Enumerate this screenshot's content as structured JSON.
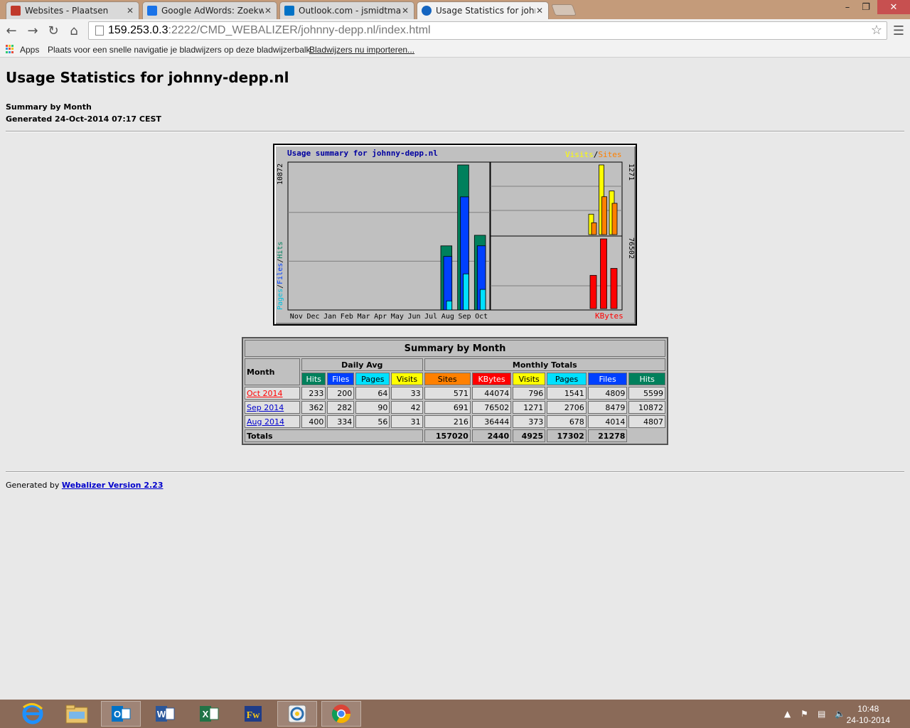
{
  "browser": {
    "tabs": [
      {
        "label": "Websites - Plaatsen",
        "favicon_color": "#c0392b",
        "active": false
      },
      {
        "label": "Google AdWords: Zoekwo",
        "favicon_color": "#1a73e8",
        "active": false
      },
      {
        "label": "Outlook.com - jsmidtman",
        "favicon_color": "#0072c6",
        "active": false
      },
      {
        "label": "Usage Statistics for johnny",
        "favicon_color": "#1565c0",
        "active": true
      }
    ],
    "url_host": "159.253.0.3",
    "url_path": ":2222/CMD_WEBALIZER/johnny-depp.nl/index.html",
    "bookmarks_apps": "Apps",
    "bookmarks_hint": "Plaats voor een snelle navigatie je bladwijzers op deze bladwijzerbalk.",
    "bookmarks_import": "Bladwijzers nu importeren..."
  },
  "page": {
    "title": "Usage Statistics for johnny-depp.nl",
    "subtitle": "Summary by Month",
    "generated": "Generated 24-Oct-2014 07:17 CEST",
    "footer_prefix": "Generated by ",
    "footer_link": "Webalizer Version 2.23"
  },
  "chart_data": {
    "type": "bar",
    "title": "Usage summary for johnny-depp.nl",
    "categories": [
      "Nov",
      "Dec",
      "Jan",
      "Feb",
      "Mar",
      "Apr",
      "May",
      "Jun",
      "Jul",
      "Aug",
      "Sep",
      "Oct"
    ],
    "left_panel": {
      "ymax_label": "10872",
      "ymax": 10872,
      "axis_label_parts": [
        "Pages",
        "/",
        "Files",
        "/",
        "Hits"
      ],
      "series": [
        {
          "name": "Hits",
          "color": "#00805c",
          "values": [
            0,
            0,
            0,
            0,
            0,
            0,
            0,
            0,
            0,
            4807,
            10872,
            5599
          ]
        },
        {
          "name": "Files",
          "color": "#0040ff",
          "values": [
            0,
            0,
            0,
            0,
            0,
            0,
            0,
            0,
            0,
            4014,
            8479,
            4809
          ]
        },
        {
          "name": "Pages",
          "color": "#00e0ff",
          "values": [
            0,
            0,
            0,
            0,
            0,
            0,
            0,
            0,
            0,
            678,
            2706,
            1541
          ]
        }
      ]
    },
    "right_top_panel": {
      "ymax_label": "1271",
      "ymax": 1271,
      "legend_parts": [
        "Visits",
        "/",
        "Sites"
      ],
      "series": [
        {
          "name": "Visits",
          "color": "#ffff00",
          "values": [
            373,
            1271,
            796
          ]
        },
        {
          "name": "Sites",
          "color": "#ff8000",
          "values": [
            216,
            691,
            571
          ]
        }
      ]
    },
    "right_bottom_panel": {
      "ymax_label": "76502",
      "ymax": 76502,
      "label": "KBytes",
      "series": [
        {
          "name": "KBytes",
          "color": "#ff0000",
          "values": [
            36444,
            76502,
            44074
          ]
        }
      ]
    }
  },
  "table": {
    "title": "Summary by Month",
    "month_header": "Month",
    "daily_avg_header": "Daily Avg",
    "monthly_totals_header": "Monthly Totals",
    "daily_cols": [
      {
        "label": "Hits",
        "color": "#00805c"
      },
      {
        "label": "Files",
        "color": "#0040ff"
      },
      {
        "label": "Pages",
        "color": "#00e0ff"
      },
      {
        "label": "Visits",
        "color": "#ffff00"
      }
    ],
    "monthly_cols": [
      {
        "label": "Sites",
        "color": "#ff8000"
      },
      {
        "label": "KBytes",
        "color": "#ff0000"
      },
      {
        "label": "Visits",
        "color": "#ffff00"
      },
      {
        "label": "Pages",
        "color": "#00e0ff"
      },
      {
        "label": "Files",
        "color": "#0040ff"
      },
      {
        "label": "Hits",
        "color": "#00805c"
      }
    ],
    "rows": [
      {
        "month": "Oct 2014",
        "current": true,
        "values": [
          "233",
          "200",
          "64",
          "33",
          "571",
          "44074",
          "796",
          "1541",
          "4809",
          "5599"
        ]
      },
      {
        "month": "Sep 2014",
        "current": false,
        "values": [
          "362",
          "282",
          "90",
          "42",
          "691",
          "76502",
          "1271",
          "2706",
          "8479",
          "10872"
        ]
      },
      {
        "month": "Aug 2014",
        "current": false,
        "values": [
          "400",
          "334",
          "56",
          "31",
          "216",
          "36444",
          "373",
          "678",
          "4014",
          "4807"
        ]
      }
    ],
    "totals_label": "Totals",
    "totals": [
      "157020",
      "2440",
      "4925",
      "17302",
      "21278"
    ]
  },
  "taskbar": {
    "apps": [
      {
        "name": "internet-explorer-icon",
        "open": false
      },
      {
        "name": "file-explorer-icon",
        "open": false
      },
      {
        "name": "outlook-icon",
        "open": true
      },
      {
        "name": "word-icon",
        "open": false
      },
      {
        "name": "excel-icon",
        "open": false
      },
      {
        "name": "expression-web-icon",
        "open": false
      },
      {
        "name": "app-icon",
        "open": true
      },
      {
        "name": "chrome-icon",
        "open": true
      }
    ],
    "time": "10:48",
    "date": "24-10-2014"
  }
}
